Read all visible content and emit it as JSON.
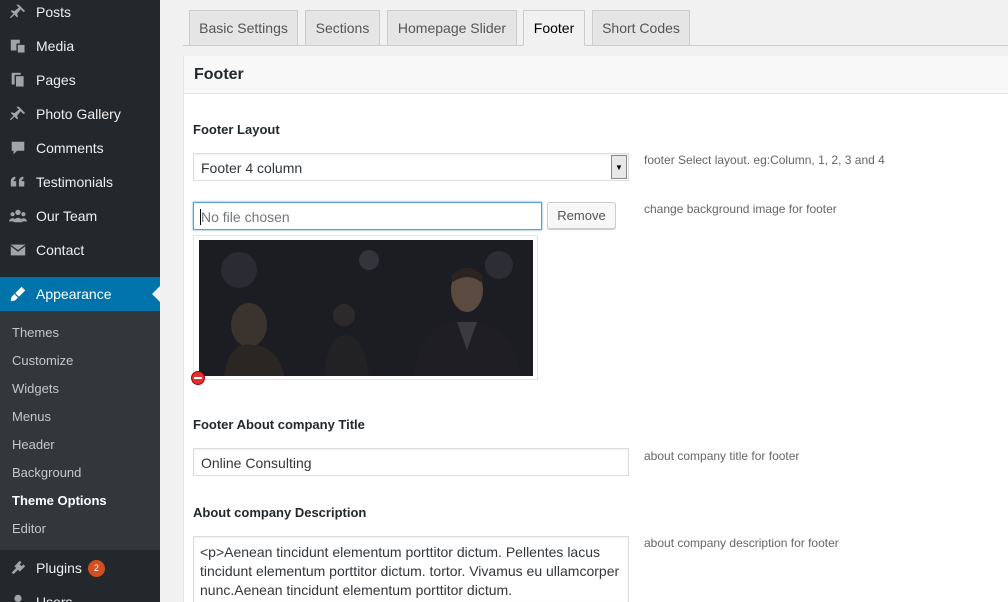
{
  "sidebar": {
    "items": [
      {
        "label": "Posts",
        "icon": "pushpin-icon"
      },
      {
        "label": "Media",
        "icon": "media-icon"
      },
      {
        "label": "Pages",
        "icon": "pages-icon"
      },
      {
        "label": "Photo Gallery",
        "icon": "pushpin-icon"
      },
      {
        "label": "Comments",
        "icon": "comment-icon"
      },
      {
        "label": "Testimonials",
        "icon": "quote-icon"
      },
      {
        "label": "Our Team",
        "icon": "team-icon"
      },
      {
        "label": "Contact",
        "icon": "mail-icon"
      },
      {
        "label": "Appearance",
        "icon": "brush-icon"
      },
      {
        "label": "Plugins",
        "icon": "plugin-icon",
        "badge": "2"
      },
      {
        "label": "Users",
        "icon": "users-icon"
      }
    ],
    "submenu": [
      "Themes",
      "Customize",
      "Widgets",
      "Menus",
      "Header",
      "Background",
      "Theme Options",
      "Editor"
    ],
    "current_submenu": "Theme Options"
  },
  "tabs": [
    "Basic Settings",
    "Sections",
    "Homepage Slider",
    "Footer",
    "Short Codes"
  ],
  "active_tab": "Footer",
  "panel": {
    "title": "Footer",
    "footer_layout": {
      "label": "Footer Layout",
      "selected": "Footer 4 column",
      "desc": "footer Select layout. eg:Column, 1, 2, 3 and 4"
    },
    "background": {
      "file_placeholder": "No file chosen",
      "remove_label": "Remove",
      "desc": "change background image for footer"
    },
    "about_title": {
      "label": "Footer About company Title",
      "value": "Online Consulting",
      "desc": "about company title for footer"
    },
    "about_desc": {
      "label": "About company Description",
      "value": "<p>Aenean tincidunt elementum porttitor dictum. Pellentes lacus tincidunt elementum porttitor dictum. tortor. Vivamus eu ullamcorper nunc.Aenean tincidunt elementum porttitor dictum.",
      "desc": "about company description for footer"
    }
  },
  "colors": {
    "sidebar_bg": "#23282d",
    "submenu_bg": "#32373c",
    "accent": "#0073aa",
    "badge": "#d54e21"
  }
}
